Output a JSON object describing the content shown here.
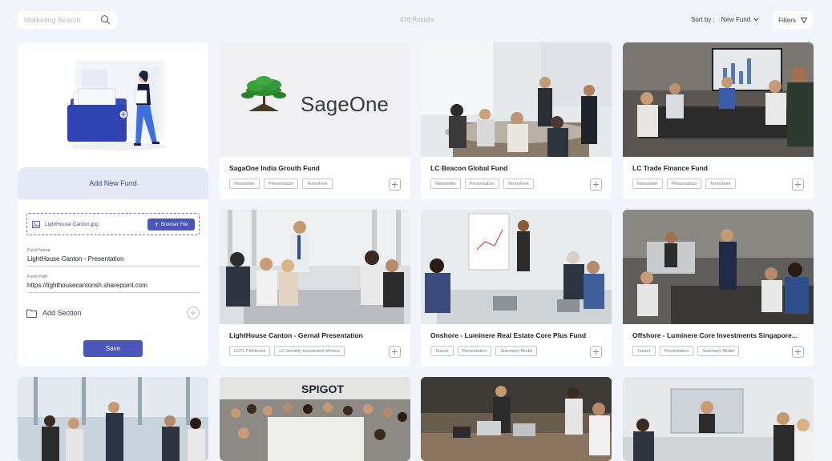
{
  "search": {
    "placeholder": "Marketing Search"
  },
  "results": "416 Results",
  "sort": {
    "label": "Sort by :",
    "value": "New Fund"
  },
  "filters": {
    "label": "Filters"
  },
  "add_panel": {
    "heading": "Add New Fund",
    "file_name": "LightHouse Canton.jpg",
    "browse_label": "Browser File",
    "fund_name_label": "Fund Name",
    "fund_name_value": "LightHouse Canton - Presentation",
    "fund_path_label": "Fund Path",
    "fund_path_value": "https://lighthousecantonsh.sharepoint.com",
    "add_section_label": "Add Section",
    "save_label": "Save"
  },
  "cards": [
    {
      "title": "SagaOne India Grouth Fund",
      "logo_text": "SageOne",
      "tags": [
        "Newsletter",
        "Presentation",
        "Termsheet"
      ]
    },
    {
      "title": "LC Beacon Global Fund",
      "tags": [
        "Newsletter",
        "Presentation",
        "Termsheet"
      ]
    },
    {
      "title": "LC Trade Finance Fund",
      "tags": [
        "Newsletter",
        "Presentation",
        "Termsheet"
      ]
    },
    {
      "title": "LightHouse Canton - Gernal Presentation",
      "tags": [
        "LCPL Pitchbook",
        "LC monthly Investment Memos"
      ]
    },
    {
      "title": "Onshore - Luminere Real Estate Core Plus Fund",
      "tags": [
        "Teaser",
        "Presentation",
        "Summary Model"
      ]
    },
    {
      "title": "Offshore - Luminere Core Investments Singapore...",
      "tags": [
        "Teaser",
        "Presentation",
        "Summary Model"
      ]
    },
    {
      "banner_text": "SPIGOT"
    }
  ],
  "colors": {
    "accent": "#4a56b8",
    "page_bg": "#f2f4fb",
    "panel_header": "#e5e8f6"
  }
}
